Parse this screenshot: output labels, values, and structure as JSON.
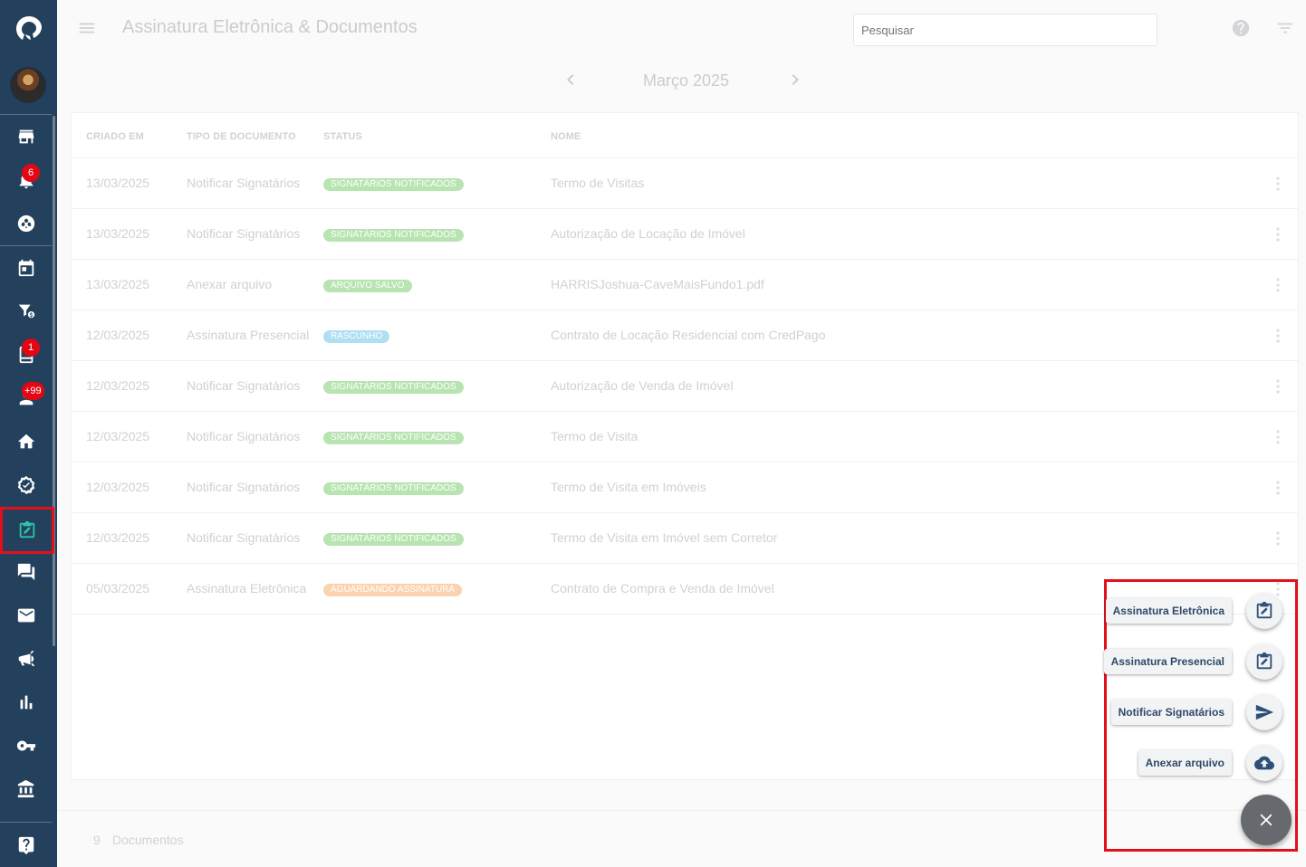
{
  "header": {
    "title": "Assinatura Eletrônica & Documentos",
    "search_placeholder": "Pesquisar"
  },
  "month_nav": {
    "label": "Março 2025"
  },
  "sidebar": {
    "badges": {
      "notifications": "6",
      "reports": "1",
      "alerts": "+99"
    },
    "items": [
      "store-icon",
      "bell-icon",
      "soccer-icon",
      "calendar-icon",
      "filter-money-icon",
      "report-icon",
      "alert-person-icon",
      "home-icon",
      "settings-check-icon",
      "signature-icon",
      "chat-icon",
      "mail-icon",
      "megaphone-icon",
      "chart-icon",
      "key-icon",
      "bank-icon",
      "help-icon"
    ]
  },
  "table": {
    "headers": [
      "CRIADO EM",
      "TIPO DE DOCUMENTO",
      "STATUS",
      "NOME"
    ],
    "rows": [
      {
        "date": "13/03/2025",
        "type": "Notificar Signatários",
        "status": "SIGNATÁRIOS NOTIFICADOS",
        "status_color": "#b7e4b0",
        "name": "Termo de Visitas"
      },
      {
        "date": "13/03/2025",
        "type": "Notificar Signatários",
        "status": "SIGNATÁRIOS NOTIFICADOS",
        "status_color": "#b7e4b0",
        "name": "Autorização de Locação de Imóvel"
      },
      {
        "date": "13/03/2025",
        "type": "Anexar arquivo",
        "status": "ARQUIVO SALVO",
        "status_color": "#b7e4b0",
        "name": "HARRISJoshua-CaveMaisFundo1.pdf"
      },
      {
        "date": "12/03/2025",
        "type": "Assinatura Presencial",
        "status": "RASCUNHO",
        "status_color": "#aee0f2",
        "name": "Contrato de Locação Residencial com CredPago"
      },
      {
        "date": "12/03/2025",
        "type": "Notificar Signatários",
        "status": "SIGNATÁRIOS NOTIFICADOS",
        "status_color": "#b7e4b0",
        "name": "Autorização de Venda de Imóvel"
      },
      {
        "date": "12/03/2025",
        "type": "Notificar Signatários",
        "status": "SIGNATÁRIOS NOTIFICADOS",
        "status_color": "#b7e4b0",
        "name": "Termo de Visita"
      },
      {
        "date": "12/03/2025",
        "type": "Notificar Signatários",
        "status": "SIGNATÁRIOS NOTIFICADOS",
        "status_color": "#b7e4b0",
        "name": "Termo de Visita em Imóveis"
      },
      {
        "date": "12/03/2025",
        "type": "Notificar Signatários",
        "status": "SIGNATÁRIOS NOTIFICADOS",
        "status_color": "#b7e4b0",
        "name": "Termo de Visita em Imóvel sem Corretor"
      },
      {
        "date": "05/03/2025",
        "type": "Assinatura Eletrônica",
        "status": "AGUARDANDO ASSINATURA",
        "status_color": "#fbd3b0",
        "name": "Contrato de Compra e Venda de Imóvel"
      }
    ]
  },
  "footer": {
    "count": "9",
    "label": "Documentos"
  },
  "fab": {
    "actions": [
      {
        "label": "Assinatura Eletrônica",
        "icon": "signature-icon"
      },
      {
        "label": "Assinatura Presencial",
        "icon": "signature-icon"
      },
      {
        "label": "Notificar Signatários",
        "icon": "send-icon"
      },
      {
        "label": "Anexar arquivo",
        "icon": "cloud-upload-icon"
      }
    ],
    "close_icon": "close-icon"
  }
}
